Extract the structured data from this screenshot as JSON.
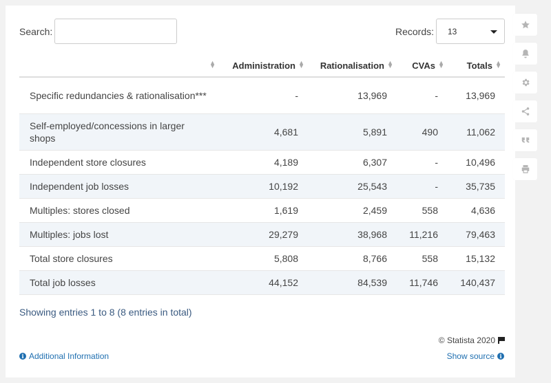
{
  "search": {
    "label": "Search:",
    "value": "",
    "placeholder": ""
  },
  "records": {
    "label": "Records:",
    "value": "13"
  },
  "table": {
    "headers": [
      "",
      "Administration",
      "Rationalisation",
      "CVAs",
      "Totals"
    ],
    "rows": [
      [
        "Specific redundancies & rationalisation***",
        "-",
        "13,969",
        "-",
        "13,969"
      ],
      [
        "Self-employed/concessions in larger shops",
        "4,681",
        "5,891",
        "490",
        "11,062"
      ],
      [
        "Independent store closures",
        "4,189",
        "6,307",
        "-",
        "10,496"
      ],
      [
        "Independent job losses",
        "10,192",
        "25,543",
        "-",
        "35,735"
      ],
      [
        "Multiples: stores closed",
        "1,619",
        "2,459",
        "558",
        "4,636"
      ],
      [
        "Multiples: jobs lost",
        "29,279",
        "38,968",
        "11,216",
        "79,463"
      ],
      [
        "Total store closures",
        "5,808",
        "8,766",
        "558",
        "15,132"
      ],
      [
        "Total job losses",
        "44,152",
        "84,539",
        "11,746",
        "140,437"
      ]
    ]
  },
  "footer": {
    "showing": "Showing entries 1 to 8 (8 entries in total)",
    "copyright": "© Statista 2020",
    "additional_info": "Additional Information",
    "show_source": "Show source"
  },
  "sidebar": {
    "icons": [
      "star-icon",
      "bell-icon",
      "gear-icon",
      "share-icon",
      "quote-icon",
      "print-icon"
    ]
  },
  "colors": {
    "link": "#1f6fb0",
    "row_alt": "#f1f5f9",
    "background": "#f2f2f2"
  }
}
